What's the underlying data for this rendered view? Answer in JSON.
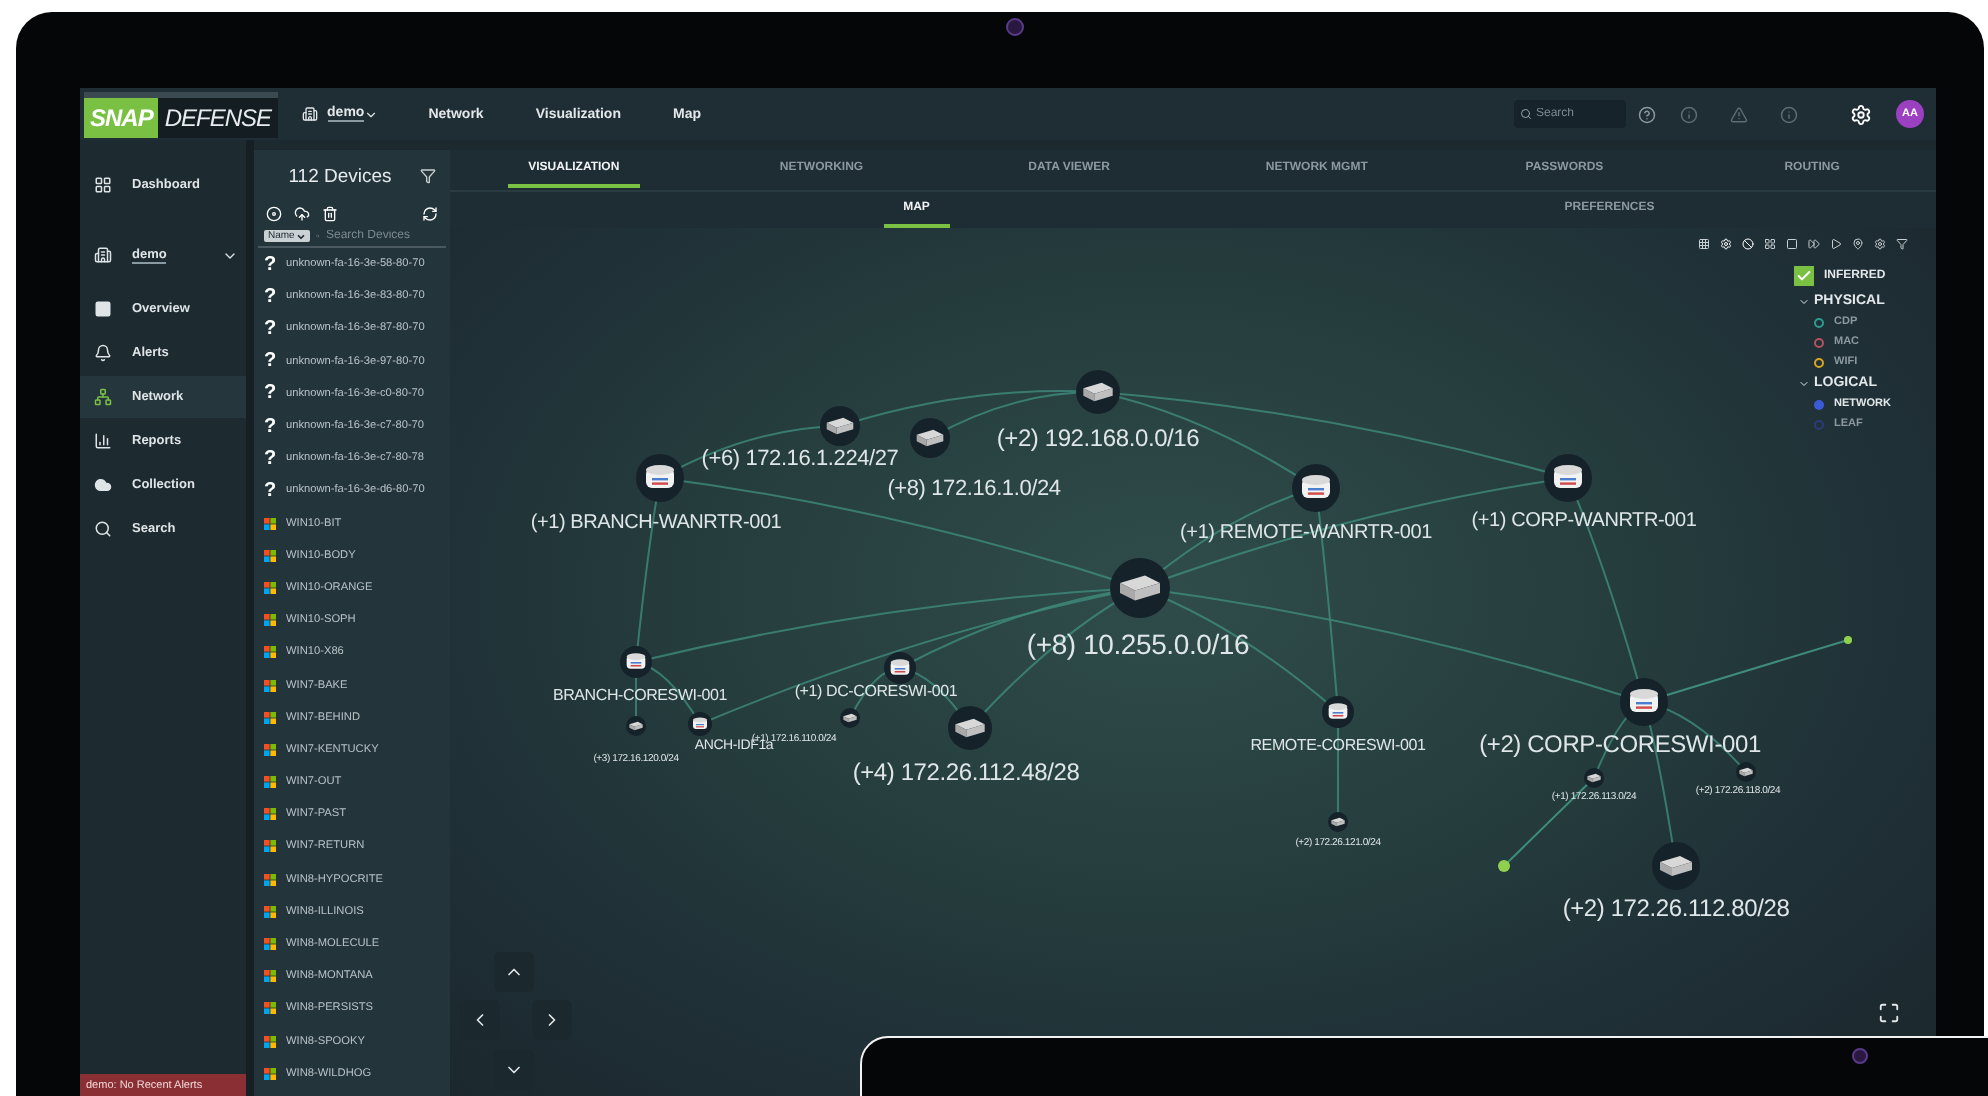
{
  "header": {
    "logo": {
      "first": "SNAP",
      "second": "DEFENSE"
    },
    "project": "demo",
    "menu": [
      "Network",
      "Visualization",
      "Map"
    ],
    "search": {
      "placeholder": "Search"
    },
    "avatar": "AA"
  },
  "sidebar": {
    "items": [
      {
        "label": "Dashboard",
        "kind": "dashboard",
        "selected": false
      },
      {
        "label": "demo",
        "kind": "project",
        "selected": false
      },
      {
        "label": "Overview",
        "kind": "overview",
        "selected": false
      },
      {
        "label": "Alerts",
        "kind": "alerts",
        "selected": false
      },
      {
        "label": "Network",
        "kind": "network",
        "selected": true
      },
      {
        "label": "Reports",
        "kind": "reports",
        "selected": false
      },
      {
        "label": "Collection",
        "kind": "collection",
        "selected": false
      },
      {
        "label": "Search",
        "kind": "search",
        "selected": false
      }
    ]
  },
  "alert_bar": "demo: No Recent Alerts",
  "devices": {
    "title": "112 Devices",
    "sort": "Name",
    "search_placeholder": "Search Devices",
    "items": [
      {
        "name": "unknown-fa-16-3e-58-80-70",
        "kind": "unknown",
        "glyph": "?"
      },
      {
        "name": "unknown-fa-16-3e-83-80-70",
        "kind": "unknown",
        "glyph": "?"
      },
      {
        "name": "unknown-fa-16-3e-87-80-70",
        "kind": "unknown",
        "glyph": "?"
      },
      {
        "name": "unknown-fa-16-3e-97-80-70",
        "kind": "unknown",
        "glyph": "?"
      },
      {
        "name": "unknown-fa-16-3e-c0-80-70",
        "kind": "unknown",
        "glyph": "?"
      },
      {
        "name": "unknown-fa-16-3e-c7-80-70",
        "kind": "unknown",
        "glyph": "?"
      },
      {
        "name": "unknown-fa-16-3e-c7-80-78",
        "kind": "unknown",
        "glyph": "?"
      },
      {
        "name": "unknown-fa-16-3e-d6-80-70",
        "kind": "unknown",
        "glyph": "?"
      },
      {
        "name": "WIN10-BIT",
        "kind": "windows"
      },
      {
        "name": "WIN10-BODY",
        "kind": "windows"
      },
      {
        "name": "WIN10-ORANGE",
        "kind": "windows"
      },
      {
        "name": "WIN10-SOPH",
        "kind": "windows"
      },
      {
        "name": "WIN10-X86",
        "kind": "windows"
      },
      {
        "name": "WIN7-BAKE",
        "kind": "windows"
      },
      {
        "name": "WIN7-BEHIND",
        "kind": "windows"
      },
      {
        "name": "WIN7-KENTUCKY",
        "kind": "windows"
      },
      {
        "name": "WIN7-OUT",
        "kind": "windows"
      },
      {
        "name": "WIN7-PAST",
        "kind": "windows"
      },
      {
        "name": "WIN7-RETURN",
        "kind": "windows"
      },
      {
        "name": "WIN8-HYPOCRITE",
        "kind": "windows"
      },
      {
        "name": "WIN8-ILLINOIS",
        "kind": "windows"
      },
      {
        "name": "WIN8-MOLECULE",
        "kind": "windows"
      },
      {
        "name": "WIN8-MONTANA",
        "kind": "windows"
      },
      {
        "name": "WIN8-PERSISTS",
        "kind": "windows"
      },
      {
        "name": "WIN8-SPOOKY",
        "kind": "windows"
      },
      {
        "name": "WIN8-WILDHOG",
        "kind": "windows"
      }
    ]
  },
  "tabs": [
    {
      "label": "VISUALIZATION",
      "selected": true
    },
    {
      "label": "NETWORKING",
      "selected": false
    },
    {
      "label": "DATA VIEWER",
      "selected": false
    },
    {
      "label": "NETWORK MGMT",
      "selected": false
    },
    {
      "label": "PASSWORDS",
      "selected": false
    },
    {
      "label": "ROUTING",
      "selected": false
    }
  ],
  "subtabs": [
    {
      "label": "MAP",
      "selected": true
    },
    {
      "label": "PREFERENCES",
      "selected": false
    }
  ],
  "legend": {
    "inferred": {
      "label": "INFERRED",
      "checked": true
    },
    "groups": [
      {
        "label": "PHYSICAL",
        "expanded": true,
        "items": [
          {
            "label": "CDP",
            "color": "#2a9d8f",
            "on": false
          },
          {
            "label": "MAC",
            "color": "#b5525f",
            "on": false
          },
          {
            "label": "WIFI",
            "color": "#d9a520",
            "on": false
          }
        ]
      },
      {
        "label": "LOGICAL",
        "expanded": true,
        "items": [
          {
            "label": "NETWORK",
            "color": "#3b5bdb",
            "on": true
          },
          {
            "label": "LEAF",
            "color": "#2b3a7a",
            "on": false
          }
        ]
      }
    ]
  },
  "map": {
    "nodes": [
      {
        "label": "(+2) 192.168.0.0/16",
        "kind": "switch"
      },
      {
        "label": "(+6) 172.16.1.224/27",
        "kind": "switch"
      },
      {
        "label": "(+8) 172.16.1.0/24",
        "kind": "switch"
      },
      {
        "label": "(+1) BRANCH-WANRTR-001",
        "kind": "router"
      },
      {
        "label": "(+1) REMOTE-WANRTR-001",
        "kind": "router"
      },
      {
        "label": "(+1) CORP-WANRTR-001",
        "kind": "router"
      },
      {
        "label": "(+8) 10.255.0.0/16",
        "kind": "switch"
      },
      {
        "label": "BRANCH-CORESWI-001",
        "kind": "router"
      },
      {
        "label": "ANCH-IDF1a",
        "kind": "router"
      },
      {
        "label": "(+3) 172.16.120.0/24",
        "kind": "switch"
      },
      {
        "label": "(+1) DC-CORESWI-001",
        "kind": "router"
      },
      {
        "label": "(+1) 172.16.110.0/24",
        "kind": "switch"
      },
      {
        "label": "(+4) 172.26.112.48/28",
        "kind": "switch"
      },
      {
        "label": "REMOTE-CORESWI-001",
        "kind": "router"
      },
      {
        "label": "(+2) 172.26.121.0/24",
        "kind": "switch"
      },
      {
        "label": "(+2) CORP-CORESWI-001",
        "kind": "router"
      },
      {
        "label": "(+1) 172.26.113.0/24",
        "kind": "switch"
      },
      {
        "label": "(+2) 172.26.118.0/24",
        "kind": "switch"
      },
      {
        "label": "(+2) 172.26.112.80/28",
        "kind": "switch"
      }
    ]
  }
}
